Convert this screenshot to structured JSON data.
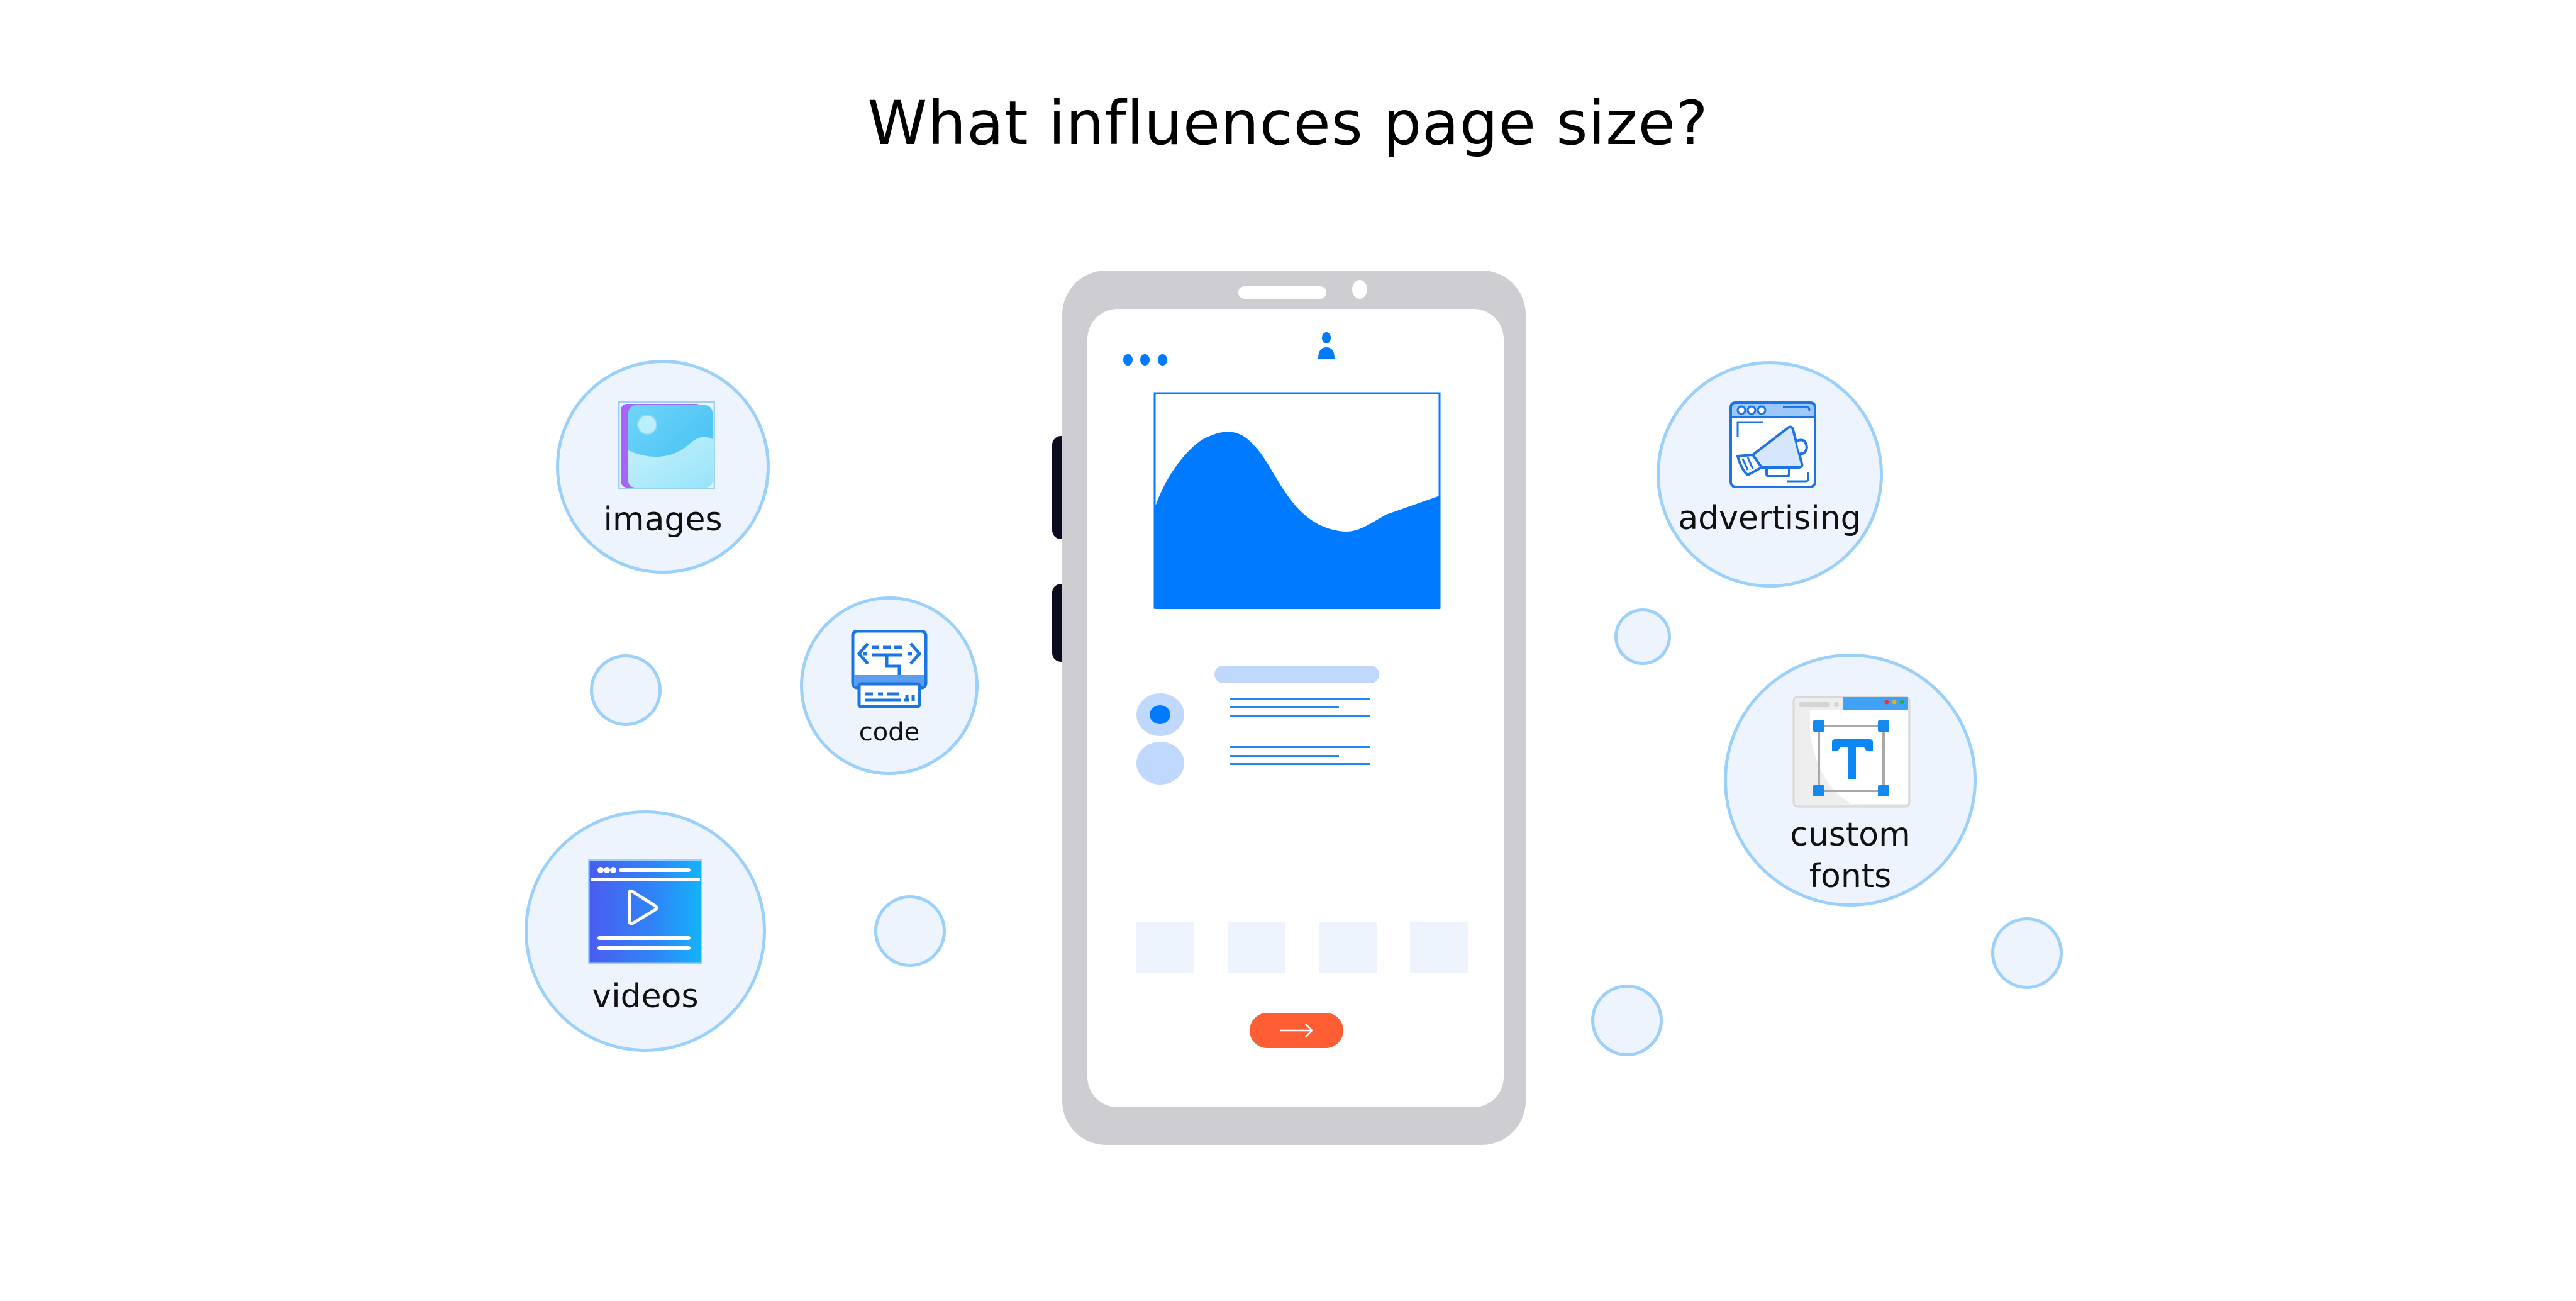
{
  "title": "What influences page size?",
  "factors": [
    {
      "id": "images",
      "label": "images",
      "icon": "image-icon"
    },
    {
      "id": "code",
      "label": "code",
      "icon": "code-icon"
    },
    {
      "id": "videos",
      "label": "videos",
      "icon": "video-player-icon"
    },
    {
      "id": "advertising",
      "label": "advertising",
      "icon": "megaphone-browser-icon"
    },
    {
      "id": "custom_fonts",
      "label_line1": "custom",
      "label_line2": "fonts",
      "icon": "font-type-icon"
    }
  ],
  "phone": {
    "menu_icon": "three-dots-icon",
    "profile_icon": "user-icon",
    "hero_icon": "wave-chart-icon",
    "list_items": [
      {
        "selected": true
      },
      {
        "selected": false
      }
    ],
    "tiles_count": 4,
    "next_button_icon": "arrow-right-icon"
  },
  "colors": {
    "bubble_fill": "#edf4fe",
    "bubble_border": "#9bd0fb",
    "accent_blue": "#007aff",
    "light_blue": "#c1d8fd",
    "phone_frame": "#cdcdd2",
    "button_orange": "#ff5d33"
  }
}
